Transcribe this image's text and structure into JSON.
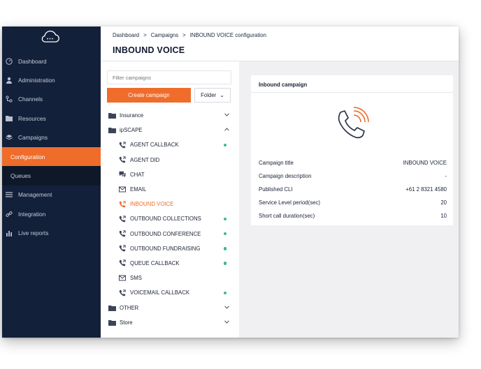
{
  "sidebar": {
    "items": [
      {
        "label": "Dashboard",
        "icon": "gauge-icon"
      },
      {
        "label": "Administration",
        "icon": "person-icon"
      },
      {
        "label": "Channels",
        "icon": "channels-icon"
      },
      {
        "label": "Resources",
        "icon": "folder-icon"
      },
      {
        "label": "Campaigns",
        "icon": "layers-icon"
      },
      {
        "label": "Configuration",
        "icon": ""
      },
      {
        "label": "Queues",
        "icon": ""
      },
      {
        "label": "Management",
        "icon": "list-icon"
      },
      {
        "label": "Integration",
        "icon": "link-icon"
      },
      {
        "label": "Live reports",
        "icon": "bar-chart-icon"
      }
    ]
  },
  "header": {
    "breadcrumb": [
      "Dashboard",
      ">",
      "Campaigns",
      ">",
      "INBOUND VOICE configuration"
    ],
    "title": "INBOUND VOICE"
  },
  "campaigns_panel": {
    "filter_placeholder": "Filter campaigns",
    "create_label": "Create campaign",
    "folder_label": "Folder",
    "tree": [
      {
        "label": "Insurance",
        "type": "group",
        "state": "collapsed"
      },
      {
        "label": "ipSCAPE",
        "type": "group",
        "state": "expanded"
      },
      {
        "label": "AGENT CALLBACK",
        "type": "item",
        "icon": "phone-out-icon",
        "online": true
      },
      {
        "label": "AGENT DID",
        "type": "item",
        "icon": "phone-out-icon",
        "online": false
      },
      {
        "label": "CHAT",
        "type": "item",
        "icon": "chat-icon",
        "online": false
      },
      {
        "label": "EMAIL",
        "type": "item",
        "icon": "envelope-icon",
        "online": false
      },
      {
        "label": "INBOUND VOICE",
        "type": "item",
        "icon": "phone-out-icon",
        "online": false,
        "selected": true
      },
      {
        "label": "OUTBOUND COLLECTIONS",
        "type": "item",
        "icon": "phone-out-icon",
        "online": true
      },
      {
        "label": "OUTBOUND CONFERENCE",
        "type": "item",
        "icon": "phone-out-icon",
        "online": true
      },
      {
        "label": "OUTBOUND FUNDRAISING",
        "type": "item",
        "icon": "phone-out-icon",
        "online": true
      },
      {
        "label": "QUEUE CALLBACK",
        "type": "item",
        "icon": "phone-out-icon",
        "online": true
      },
      {
        "label": "SMS",
        "type": "item",
        "icon": "envelope-icon",
        "online": false
      },
      {
        "label": "VOICEMAIL CALLBACK",
        "type": "item",
        "icon": "phone-out-icon",
        "online": true
      },
      {
        "label": "OTHER",
        "type": "group",
        "state": "collapsed"
      },
      {
        "label": "Store",
        "type": "group",
        "state": "collapsed"
      }
    ]
  },
  "inbound_campaign": {
    "heading": "Inbound campaign",
    "fields": [
      {
        "label": "Campaign title",
        "value": "INBOUND VOICE"
      },
      {
        "label": "Campaign description",
        "value": "-"
      },
      {
        "label": "Published CLI",
        "value": "+61 2 8321 4580"
      },
      {
        "label": "Service Level period(sec)",
        "value": "20"
      },
      {
        "label": "Short call duration(sec)",
        "value": "10"
      }
    ]
  },
  "colors": {
    "sidebar_bg": "#13203a",
    "accent": "#ef6c2b",
    "online_dot": "#3fb88a"
  }
}
